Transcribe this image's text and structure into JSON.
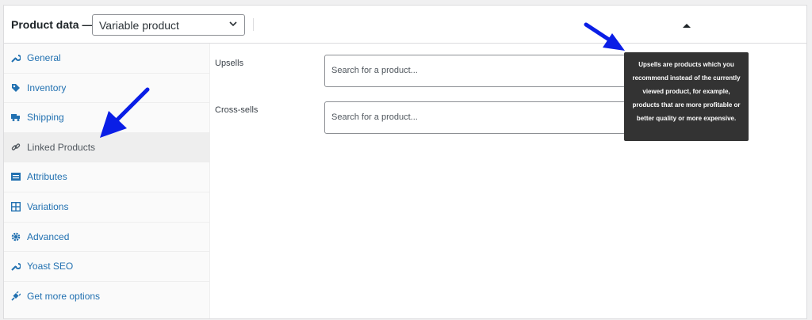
{
  "header": {
    "title": "Product data —",
    "product_type": "Variable product"
  },
  "sidebar": {
    "items": [
      {
        "label": "General",
        "icon": "wrench-icon"
      },
      {
        "label": "Inventory",
        "icon": "tag-icon"
      },
      {
        "label": "Shipping",
        "icon": "truck-icon"
      },
      {
        "label": "Linked Products",
        "icon": "link-icon",
        "active": true
      },
      {
        "label": "Attributes",
        "icon": "list-icon"
      },
      {
        "label": "Variations",
        "icon": "grid-icon"
      },
      {
        "label": "Advanced",
        "icon": "gear-icon"
      },
      {
        "label": "Yoast SEO",
        "icon": "wrench-icon"
      },
      {
        "label": "Get more options",
        "icon": "plug-icon"
      }
    ]
  },
  "fields": {
    "upsells": {
      "label": "Upsells",
      "placeholder": "Search for a product..."
    },
    "cross_sells": {
      "label": "Cross-sells",
      "placeholder": "Search for a product..."
    }
  },
  "tooltip": {
    "text": "Upsells are products which you recommend instead of the currently viewed product, for example, products that are more profitable or better quality or more expensive."
  },
  "colors": {
    "link": "#2271b1",
    "tooltip_bg": "#333333",
    "annotation_arrow": "#0a1ee6"
  }
}
